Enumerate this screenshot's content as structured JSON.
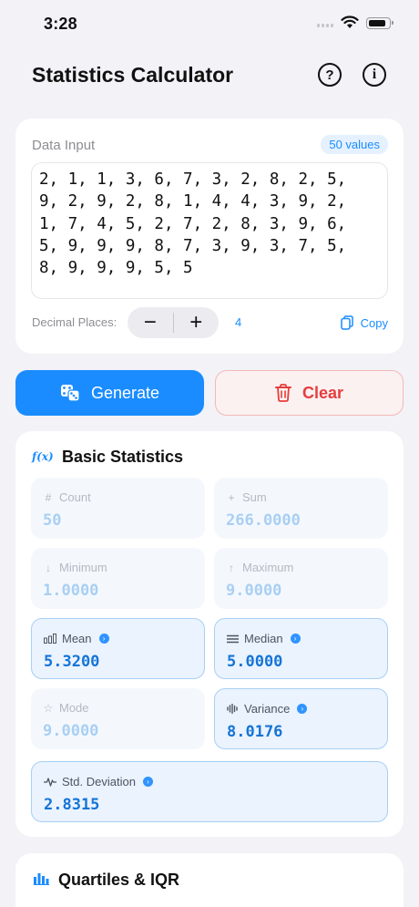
{
  "status": {
    "time": "3:28"
  },
  "header": {
    "title": "Statistics Calculator",
    "help_icon": "question-circle-icon",
    "info_icon": "info-circle-icon"
  },
  "input": {
    "label": "Data Input",
    "count_badge": "50 values",
    "data_text": "2, 1, 1, 3, 6, 7, 3, 2, 8, 2, 5,\n9, 2, 9, 2, 8, 1, 4, 4, 3, 9, 2,\n1, 7, 4, 5, 2, 7, 2, 8, 3, 9, 6,\n5, 9, 9, 9, 8, 7, 3, 9, 3, 7, 5,\n8, 9, 9, 9, 5, 5",
    "decimal_label": "Decimal Places:",
    "minus": "−",
    "plus": "+",
    "decimal_value": "4",
    "copy_label": "Copy"
  },
  "actions": {
    "generate_label": "Generate",
    "clear_label": "Clear"
  },
  "basic": {
    "title": "Basic Statistics",
    "icon_text": "f(x)",
    "stats": [
      {
        "label": "Count",
        "value": "50",
        "icon": "#"
      },
      {
        "label": "Sum",
        "value": "266.0000",
        "icon": "+"
      },
      {
        "label": "Minimum",
        "value": "1.0000",
        "icon": "↓"
      },
      {
        "label": "Maximum",
        "value": "9.0000",
        "icon": "↑"
      },
      {
        "label": "Mean",
        "value": "5.3200",
        "icon": "bar-chart-icon"
      },
      {
        "label": "Median",
        "value": "5.0000",
        "icon": "lines-icon"
      },
      {
        "label": "Mode",
        "value": "9.0000",
        "icon": "☆"
      },
      {
        "label": "Variance",
        "value": "8.0176",
        "icon": "waveform-icon"
      },
      {
        "label": "Std. Deviation",
        "value": "2.8315",
        "icon": "pulse-icon"
      }
    ]
  },
  "quartiles": {
    "title": "Quartiles & IQR"
  },
  "colors": {
    "accent": "#1a8cff",
    "danger": "#e63d3d",
    "background": "#f2f2f7"
  }
}
